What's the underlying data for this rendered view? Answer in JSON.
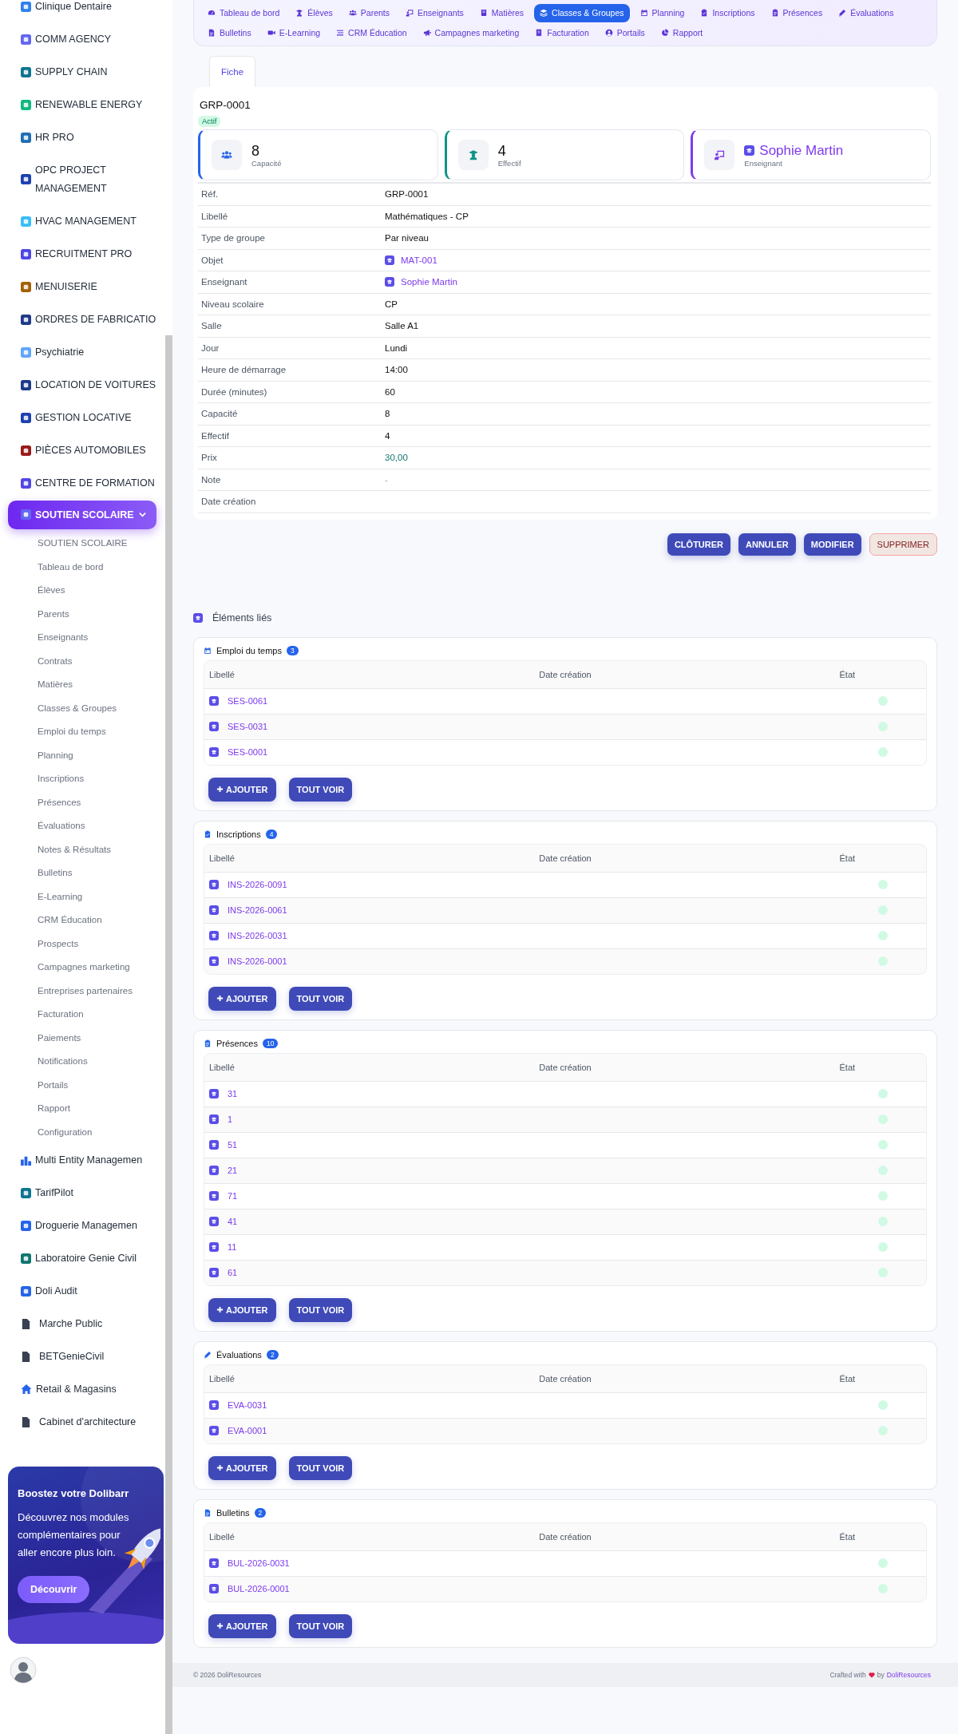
{
  "sidebar": {
    "items": [
      {
        "label": "Clinique Dentaire",
        "kind": "app",
        "color": "#2f80ed",
        "selected": false
      },
      {
        "label": "COMM AGENCY",
        "kind": "app",
        "color": "#6366f1",
        "selected": false
      },
      {
        "label": "SUPPLY CHAIN",
        "kind": "app",
        "color": "#0e7490",
        "selected": false
      },
      {
        "label": "RENEWABLE ENERGY",
        "kind": "app",
        "color": "#10b981",
        "selected": false
      },
      {
        "label": "HR PRO",
        "kind": "app",
        "color": "#1e6fb5",
        "selected": false
      },
      {
        "label": "OPC PROJECT MANAGEMENT",
        "kind": "app",
        "color": "#1e40af",
        "selected": false
      },
      {
        "label": "HVAC MANAGEMENT",
        "kind": "app",
        "color": "#38bdf8",
        "selected": false
      },
      {
        "label": "RECRUITMENT PRO",
        "kind": "app",
        "color": "#4f46e5",
        "selected": false
      },
      {
        "label": "MENUISERIE",
        "kind": "app",
        "color": "#a16207",
        "selected": false
      },
      {
        "label": "ORDRES DE FABRICATIO",
        "kind": "app",
        "color": "#1e3a8a",
        "selected": false
      },
      {
        "label": "Psychiatrie",
        "kind": "app",
        "color": "#60a5fa",
        "selected": false
      },
      {
        "label": "LOCATION DE VOITURES",
        "kind": "app",
        "color": "#1e3a8a",
        "selected": false
      },
      {
        "label": "GESTION LOCATIVE",
        "kind": "app",
        "color": "#1e40af",
        "selected": false
      },
      {
        "label": "PIÈCES AUTOMOBILES",
        "kind": "app",
        "color": "#991b1b",
        "selected": false
      },
      {
        "label": "CENTRE DE FORMATION",
        "kind": "app",
        "color": "#4f46e5",
        "selected": false
      },
      {
        "label": "SOUTIEN SCOLAIRE",
        "kind": "app",
        "color": "#6366f1",
        "selected": true,
        "expanded": true,
        "children": [
          {
            "label": "SOUTIEN SCOLAIRE",
            "selected": false
          },
          {
            "label": "Tableau de bord",
            "selected": false
          },
          {
            "label": "Élèves",
            "selected": false
          },
          {
            "label": "Parents",
            "selected": false
          },
          {
            "label": "Enseignants",
            "selected": false
          },
          {
            "label": "Contrats",
            "selected": false
          },
          {
            "label": "Matières",
            "selected": false
          },
          {
            "label": "Classes & Groupes",
            "selected": false
          },
          {
            "label": "Emploi du temps",
            "selected": false
          },
          {
            "label": "Planning",
            "selected": false
          },
          {
            "label": "Inscriptions",
            "selected": false
          },
          {
            "label": "Présences",
            "selected": false
          },
          {
            "label": "Évaluations",
            "selected": false
          },
          {
            "label": "Notes & Résultats",
            "selected": false
          },
          {
            "label": "Bulletins",
            "selected": false
          },
          {
            "label": "E-Learning",
            "selected": false
          },
          {
            "label": "CRM Éducation",
            "selected": false
          },
          {
            "label": "Prospects",
            "selected": false
          },
          {
            "label": "Campagnes marketing",
            "selected": false
          },
          {
            "label": "Entreprises partenaires",
            "selected": false
          },
          {
            "label": "Facturation",
            "selected": false
          },
          {
            "label": "Paiements",
            "selected": false
          },
          {
            "label": "Notifications",
            "selected": false
          },
          {
            "label": "Portails",
            "selected": false
          },
          {
            "label": "Rapport",
            "selected": false
          },
          {
            "label": "Configuration",
            "selected": false
          }
        ]
      },
      {
        "label": "Multi Entity Managemen",
        "kind": "bars",
        "color": "#2563eb",
        "selected": false
      },
      {
        "label": "TarifPilot",
        "kind": "app",
        "color": "#0e7490",
        "selected": false
      },
      {
        "label": "Droguerie Managemen",
        "kind": "app",
        "color": "#2563eb",
        "selected": false
      },
      {
        "label": "Laboratoire Genie Civil",
        "kind": "app",
        "color": "#0f766e",
        "selected": false
      },
      {
        "label": "Doli Audit",
        "kind": "app",
        "color": "#2563eb",
        "selected": false
      },
      {
        "label": "Marche Public",
        "kind": "doc",
        "color": "#374151",
        "selected": false
      },
      {
        "label": "BETGenieCivil",
        "kind": "doc",
        "color": "#374151",
        "selected": false
      },
      {
        "label": "Retail & Magasins",
        "kind": "home",
        "color": "#2563eb",
        "selected": false
      },
      {
        "label": "Cabinet d'architecture",
        "kind": "doc",
        "color": "#374151",
        "selected": false
      }
    ],
    "promo": {
      "title": "Boostez votre Dolibarr",
      "text": "Découvrez nos modules complémentaires pour aller encore plus loin.",
      "button": "Découvrir"
    }
  },
  "nav": [
    {
      "label": "Tableau de bord",
      "kind": "dashboard",
      "selected": false
    },
    {
      "label": "Élèves",
      "kind": "students",
      "selected": false
    },
    {
      "label": "Parents",
      "kind": "parents",
      "selected": false
    },
    {
      "label": "Enseignants",
      "kind": "teachers",
      "selected": false
    },
    {
      "label": "Matières",
      "kind": "subjects",
      "selected": false
    },
    {
      "label": "Classes & Groupes",
      "kind": "classes",
      "selected": true
    },
    {
      "label": "Planning",
      "kind": "planning",
      "selected": false
    },
    {
      "label": "Inscriptions",
      "kind": "enroll",
      "selected": false
    },
    {
      "label": "Présences",
      "kind": "attendance",
      "selected": false
    },
    {
      "label": "Évaluations",
      "kind": "evaluations",
      "selected": false
    },
    {
      "label": "Bulletins",
      "kind": "bulletins",
      "selected": false
    },
    {
      "label": "E-Learning",
      "kind": "elearning",
      "selected": false
    },
    {
      "label": "CRM Éducation",
      "kind": "crm",
      "selected": false
    },
    {
      "label": "Campagnes marketing",
      "kind": "campaign",
      "selected": false
    },
    {
      "label": "Facturation",
      "kind": "billing",
      "selected": false
    },
    {
      "label": "Portails",
      "kind": "portals",
      "selected": false
    },
    {
      "label": "Rapport",
      "kind": "report",
      "selected": false
    }
  ],
  "record": {
    "tabs": [
      {
        "label": "Fiche",
        "selected": true
      }
    ],
    "title": "GRP-0001",
    "status": "Actif",
    "stats": [
      {
        "kind": "number",
        "value": "8",
        "label": "Capacité",
        "color": "#2563eb"
      },
      {
        "kind": "number",
        "value": "4",
        "label": "Effectif",
        "color": "#0d9488"
      },
      {
        "kind": "link",
        "value": "Sophie Martin",
        "label": "Enseignant",
        "color": "#7c3aed"
      }
    ],
    "fields": [
      {
        "label": "Réf.",
        "kind": "text",
        "value": "GRP-0001"
      },
      {
        "label": "Libellé",
        "kind": "text",
        "value": "Mathématiques - CP"
      },
      {
        "label": "Type de groupe",
        "kind": "text",
        "value": "Par niveau"
      },
      {
        "label": "Objet",
        "kind": "link",
        "value": "MAT-001"
      },
      {
        "label": "Enseignant",
        "kind": "link",
        "value": "Sophie Martin"
      },
      {
        "label": "Niveau scolaire",
        "kind": "text",
        "value": "CP"
      },
      {
        "label": "Salle",
        "kind": "text",
        "value": "Salle A1"
      },
      {
        "label": "Jour",
        "kind": "text",
        "value": "Lundi"
      },
      {
        "label": "Heure de démarrage",
        "kind": "text",
        "value": "14:00"
      },
      {
        "label": "Durée (minutes)",
        "kind": "text",
        "value": "60"
      },
      {
        "label": "Capacité",
        "kind": "text",
        "value": "8"
      },
      {
        "label": "Effectif",
        "kind": "text",
        "value": "4"
      },
      {
        "label": "Prix",
        "kind": "money",
        "value": "30,00"
      },
      {
        "label": "Note",
        "kind": "muted",
        "value": "-"
      },
      {
        "label": "Date création",
        "kind": "text"
      }
    ],
    "actions": [
      {
        "label": "CLÔTURER",
        "kind": "primary"
      },
      {
        "label": "ANNULER",
        "kind": "primary"
      },
      {
        "label": "MODIFIER",
        "kind": "primary"
      },
      {
        "label": "SUPPRIMER",
        "kind": "danger"
      }
    ]
  },
  "related": {
    "title": "Éléments liés",
    "panels": [
      {
        "title": "Emploi du temps",
        "kind": "planning",
        "count": "3",
        "columns": [
          "Libellé",
          "Date création",
          "État"
        ],
        "rows": [
          {
            "ref": "SES-0061",
            "color": "#d1fae5"
          },
          {
            "ref": "SES-0031",
            "color": "#d1fae5"
          },
          {
            "ref": "SES-0001",
            "color": "#d1fae5"
          }
        ],
        "buttons": [
          {
            "label": "AJOUTER",
            "kind": "add"
          },
          {
            "label": "TOUT VOIR",
            "kind": "all"
          }
        ]
      },
      {
        "title": "Inscriptions",
        "kind": "enroll",
        "count": "4",
        "columns": [
          "Libellé",
          "Date création",
          "État"
        ],
        "rows": [
          {
            "ref": "INS-2026-0091",
            "color": "#d1fae5"
          },
          {
            "ref": "INS-2026-0061",
            "color": "#d1fae5"
          },
          {
            "ref": "INS-2026-0031",
            "color": "#d1fae5"
          },
          {
            "ref": "INS-2026-0001",
            "color": "#d1fae5"
          }
        ],
        "buttons": [
          {
            "label": "AJOUTER",
            "kind": "add"
          },
          {
            "label": "TOUT VOIR",
            "kind": "all"
          }
        ]
      },
      {
        "title": "Présences",
        "kind": "attendance",
        "count": "10",
        "columns": [
          "Libellé",
          "Date création",
          "État"
        ],
        "rows": [
          {
            "ref": "31",
            "color": "#d1fae5"
          },
          {
            "ref": "1",
            "color": "#d1fae5"
          },
          {
            "ref": "51",
            "color": "#d1fae5"
          },
          {
            "ref": "21",
            "color": "#d1fae5"
          },
          {
            "ref": "71",
            "color": "#d1fae5"
          },
          {
            "ref": "41",
            "color": "#d1fae5"
          },
          {
            "ref": "11",
            "color": "#d1fae5"
          },
          {
            "ref": "61",
            "color": "#d1fae5"
          }
        ],
        "buttons": [
          {
            "label": "AJOUTER",
            "kind": "add"
          },
          {
            "label": "TOUT VOIR",
            "kind": "all"
          }
        ]
      },
      {
        "title": "Évaluations",
        "kind": "evaluations",
        "count": "2",
        "columns": [
          "Libellé",
          "Date création",
          "État"
        ],
        "rows": [
          {
            "ref": "EVA-0031",
            "color": "#d1fae5"
          },
          {
            "ref": "EVA-0001",
            "color": "#d1fae5"
          }
        ],
        "buttons": [
          {
            "label": "AJOUTER",
            "kind": "add"
          },
          {
            "label": "TOUT VOIR",
            "kind": "all"
          }
        ]
      },
      {
        "title": "Bulletins",
        "kind": "bulletins",
        "count": "2",
        "columns": [
          "Libellé",
          "Date création",
          "État"
        ],
        "rows": [
          {
            "ref": "BUL-2026-0031",
            "color": "#d1fae5"
          },
          {
            "ref": "BUL-2026-0001",
            "color": "#d1fae5"
          }
        ],
        "buttons": [
          {
            "label": "AJOUTER",
            "kind": "add"
          },
          {
            "label": "TOUT VOIR",
            "kind": "all"
          }
        ]
      }
    ]
  },
  "footer": {
    "copyright": "© 2026 DoliResources",
    "credit_prefix": "Crafted with",
    "credit_by": "by",
    "credit_link": "DoliResources"
  }
}
